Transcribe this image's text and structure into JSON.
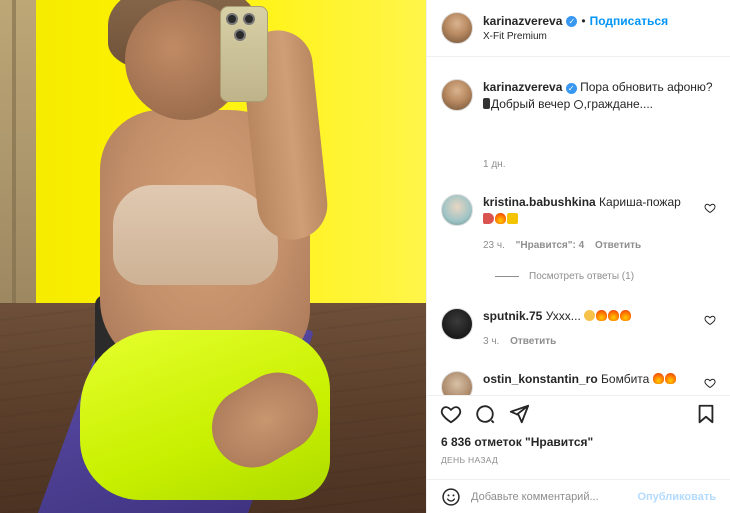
{
  "post": {
    "author": "karinazvereva",
    "follow_label": "Подписаться",
    "separator": "•",
    "location": "X-Fit Premium",
    "caption": {
      "user": "karinazvereva",
      "text_a": "Пора обновить афоню?",
      "text_b": "Добрый вечер",
      "text_c": ",граждане....",
      "time": "1 дн."
    },
    "likes": "6 836 отметок \"Нравится\"",
    "date": "ДЕНЬ НАЗАД"
  },
  "comments": [
    {
      "user": "kristina.babushkina",
      "text": "Кариша-пожар",
      "time": "23 ч.",
      "likes": "\"Нравится\": 4",
      "reply": "Ответить",
      "view_replies": "Посмотреть ответы (1)"
    },
    {
      "user": "sputnik.75",
      "text": "Уххх...",
      "time": "3 ч.",
      "reply": "Ответить"
    },
    {
      "user": "ostin_konstantin_ro",
      "text": "Бомбита"
    }
  ],
  "composer": {
    "placeholder": "Добавьте комментарий...",
    "publish_label": "Опубликовать"
  },
  "icons": {
    "verified": "verified-badge-icon",
    "like": "heart-icon",
    "comment": "comment-bubble-icon",
    "share": "paper-plane-icon",
    "save": "bookmark-icon",
    "emoji": "smiley-icon"
  },
  "colors": {
    "link": "#0095f6",
    "verified": "#3897f0",
    "muted": "#8e8e8e",
    "publish_disabled": "#b3dbff"
  }
}
